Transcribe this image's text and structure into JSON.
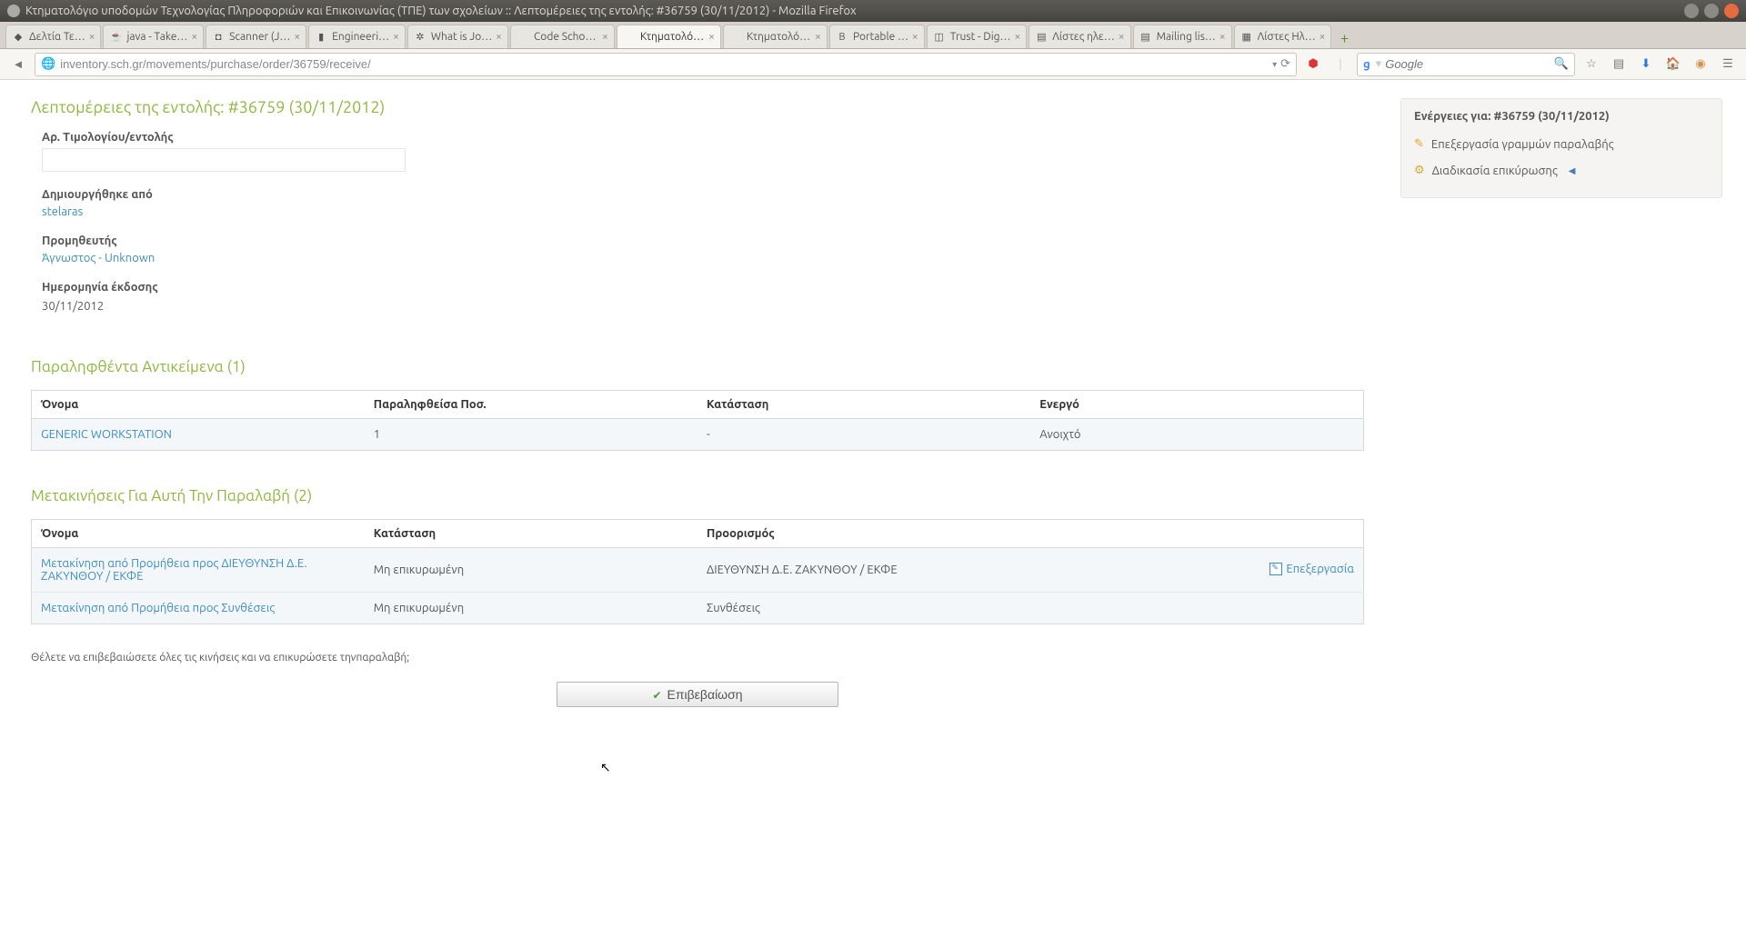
{
  "window": {
    "title": "Κτηματολόγιο υποδομών Τεχνολογίας Πληροφοριών και Επικοινωνίας (ΤΠΕ) των σχολείων :: Λεπτομέρειες της εντολής: #36759 (30/11/2012) - Mozilla Firefox"
  },
  "tabs": [
    {
      "label": "Δελτία Τε…",
      "icon": "◆"
    },
    {
      "label": "java - Take…",
      "icon": "☕"
    },
    {
      "label": "Scanner (J…",
      "icon": "◘"
    },
    {
      "label": "Engineeri…",
      "icon": "▮"
    },
    {
      "label": "What is Jo…",
      "icon": "✲"
    },
    {
      "label": "Code School -…",
      "icon": ""
    },
    {
      "label": "Κτηματολόγι…",
      "icon": "",
      "active": true
    },
    {
      "label": "Κτηματολόγι…",
      "icon": ""
    },
    {
      "label": "Portable …",
      "icon": "B"
    },
    {
      "label": "Trust - Dig…",
      "icon": "◫"
    },
    {
      "label": "Λίστες ηλε…",
      "icon": "▤"
    },
    {
      "label": "Mailing lis…",
      "icon": "▤"
    },
    {
      "label": "Λίστες Ηλ…",
      "icon": "▦"
    }
  ],
  "nav": {
    "url": "inventory.sch.gr/movements/purchase/order/36759/receive/",
    "search_placeholder": "Google"
  },
  "order": {
    "heading": "Λεπτομέρειες της εντολής: #36759 (30/11/2012)",
    "invoice_label": "Αρ. Τιμολογίου/εντολής",
    "invoice_value": "",
    "created_by_label": "Δημιουργήθηκε από",
    "created_by_value": "stelaras",
    "supplier_label": "Προμηθευτής",
    "supplier_value": "Άγνωστος - Unknown",
    "issue_date_label": "Ημερομηνία έκδοσης",
    "issue_date_value": "30/11/2012"
  },
  "received": {
    "heading": "Παραληφθέντα Αντικείμενα (1)",
    "cols": {
      "name": "Όνομα",
      "qty": "Παραληφθείσα Ποσ.",
      "status": "Κατάσταση",
      "active": "Ενεργό"
    },
    "rows": [
      {
        "name": "GENERIC WORKSTATION",
        "qty": "1",
        "status": "-",
        "active": "Ανοιχτό"
      }
    ]
  },
  "movements": {
    "heading": "Μετακινήσεις Για Αυτή Την Παραλαβή (2)",
    "cols": {
      "name": "Όνομα",
      "status": "Κατάσταση",
      "dest": "Προορισμός"
    },
    "edit_label": "Επεξεργασία",
    "rows": [
      {
        "name": "Μετακίνηση από Προμήθεια προς ΔΙΕΥΘΥΝΣΗ Δ.Ε. ΖΑΚΥΝΘΟΥ / ΕΚΦΕ",
        "status": "Μη επικυρωμένη",
        "dest": "ΔΙΕΥΘΥΝΣΗ Δ.Ε. ΖΑΚΥΝΘΟΥ / ΕΚΦΕ",
        "editable": true
      },
      {
        "name": "Μετακίνηση από Προμήθεια προς Συνθέσεις",
        "status": "Μη επικυρωμένη",
        "dest": "Συνθέσεις",
        "editable": false
      }
    ]
  },
  "confirm": {
    "question": "Θέλετε να επιβεβαιώσετε όλες τις κινήσεις και να επικυρώσετε τηνπαραλαβή;",
    "button": "Επιβεβαίωση"
  },
  "sidebar": {
    "heading": "Ενέργειες για: #36759 (30/11/2012)",
    "actions": [
      {
        "icon": "pencil",
        "label": "Επεξεργασία γραμμών παραλαβής"
      },
      {
        "icon": "gear",
        "label": "Διαδικασία επικύρωσης",
        "arrow": true
      }
    ]
  }
}
